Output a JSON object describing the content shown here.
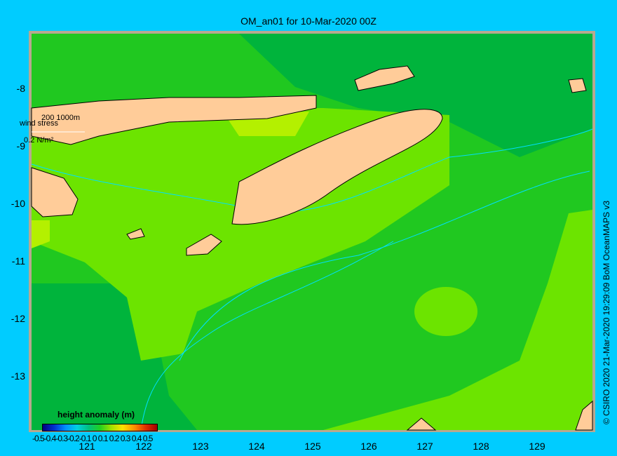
{
  "title": "OM_an01 for 10-Mar-2020 00Z",
  "map": {
    "lon_range": [
      120,
      130
    ],
    "lat_range": [
      -14,
      -7
    ],
    "lat_ticks": [
      "-8",
      "-9",
      "-10",
      "-11",
      "-12",
      "-13"
    ],
    "lon_ticks": [
      "121",
      "122",
      "123",
      "124",
      "125",
      "126",
      "127",
      "128",
      "129"
    ],
    "contour_labels": "200  1000m",
    "wind_label": "wind stress",
    "wind_scale": "0.2 N/m²",
    "colors": {
      "background": "#00ccff",
      "land": "#ffcc99",
      "shelf": "#b8a890",
      "dark_green": "#00b43c",
      "mid_green": "#20c820",
      "light_green": "#6ce400",
      "yellow_green": "#b4f000",
      "contour": "#00e0ff"
    }
  },
  "legend": {
    "title": "height anomaly (m)",
    "ticks": "-0.5-0.4-0.3-0.2-0.1 0 0.1 0.2 0.3 0.4 0.5",
    "range": [
      -0.5,
      0.5
    ]
  },
  "credit": "© CSIRO 2020    21-Mar-2020 19:29:09 BoM OceanMAPS v3"
}
